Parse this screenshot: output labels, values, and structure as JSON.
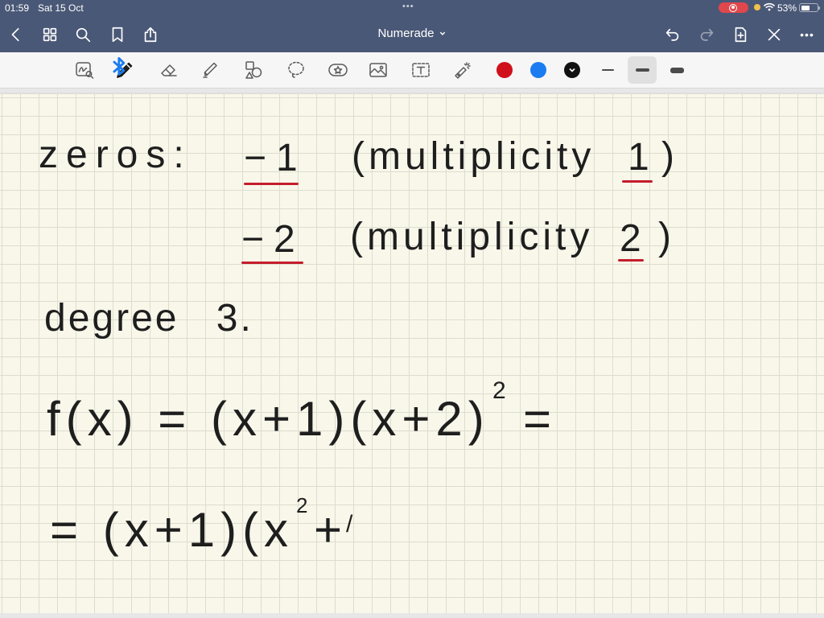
{
  "status_bar": {
    "time": "01:59",
    "date": "Sat 15 Oct",
    "multitask_dots": "•••",
    "battery_percent": "53%",
    "battery_level": 0.53
  },
  "nav_bar": {
    "title": "Numerade",
    "more_label": "•••",
    "left_icons": [
      "back-icon",
      "grid-icon",
      "search-icon",
      "bookmark-icon",
      "share-icon"
    ],
    "right_icons": [
      "undo-icon",
      "redo-icon",
      "add-page-icon",
      "close-icon",
      "more-icon"
    ]
  },
  "toolbar": {
    "tools": [
      "zoom-window-icon",
      "pen-icon",
      "eraser-icon",
      "highlighter-icon",
      "shapes-icon",
      "lasso-icon",
      "elements-icon",
      "image-icon",
      "text-icon",
      "laser-pointer-icon"
    ],
    "selected_tool": "pen-icon",
    "colors": [
      "#d0101b",
      "#1a7cf0",
      "#111111"
    ],
    "selected_color_index": 2,
    "stroke_widths": [
      "stroke-thin-icon",
      "stroke-medium-icon",
      "stroke-thick-icon"
    ],
    "selected_stroke_width": "stroke-medium-icon"
  },
  "theme": {
    "header_bg": "#4a5877",
    "toolbar_bg": "#f6f6f6",
    "paper_bg": "#f8f7ea",
    "grid_line": "#dcdccf",
    "ink": "#1e1e1e",
    "underline_red": "#c41d2b",
    "recording_red": "#e0474c"
  },
  "note": {
    "zeros_label": "zeros:",
    "zero_1": {
      "value": "−1",
      "multiplicity_open": "(multiplicity",
      "multiplicity": "1",
      "close": ")"
    },
    "zero_2": {
      "value": "−2",
      "multiplicity_open": "(multiplicity",
      "multiplicity": "2",
      "close": ")"
    },
    "degree": "degree 3.",
    "function_line": {
      "expr": "f(x) = (x+1)(x+2)",
      "exponent": "2",
      "tail": "="
    },
    "expansion_line": {
      "expr": "= (x+1)(x",
      "exponent": "2",
      "tail": "+",
      "partial_stroke": "/"
    }
  }
}
